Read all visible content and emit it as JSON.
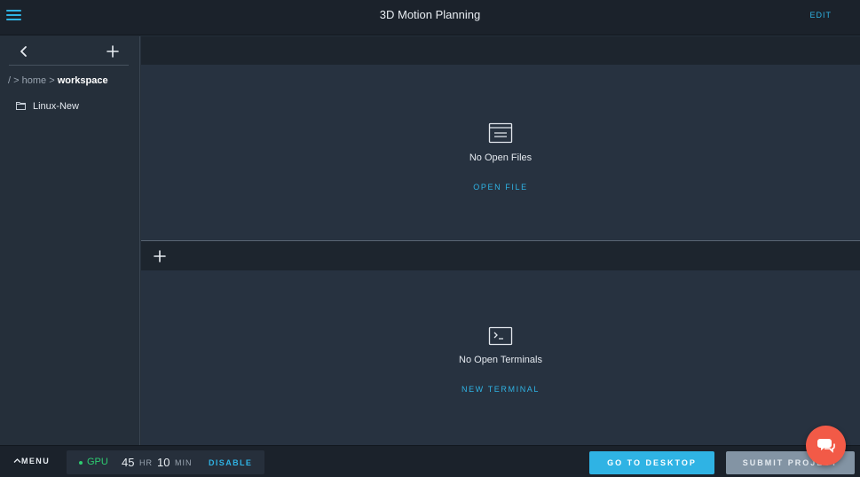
{
  "app": {
    "title": "3D Motion Planning",
    "edit_label": "EDIT",
    "accent_color": "#2fb3e4",
    "icons": {
      "menu": "hamburger-icon",
      "back": "chevron-left-icon",
      "add": "plus-icon",
      "folder": "folder-icon",
      "files": "file-list-icon",
      "terminal": "terminal-icon",
      "chat": "chat-icon",
      "caret": "caret-up-icon"
    }
  },
  "sidebar": {
    "breadcrumb": {
      "root": "/",
      "sep1": ">",
      "home": "home",
      "sep2": ">",
      "current": "workspace"
    },
    "items": [
      {
        "label": "Linux-New",
        "icon": "folder-icon"
      }
    ]
  },
  "editor": {
    "empty_message": "No Open Files",
    "action_label": "OPEN FILE"
  },
  "terminal": {
    "empty_message": "No Open Terminals",
    "action_label": "NEW TERMINAL"
  },
  "bottombar": {
    "menu_label": "MENU",
    "gpu": {
      "label": "GPU",
      "status_color": "#2ecc71",
      "hours": "45",
      "hours_unit": "HR",
      "minutes": "10",
      "minutes_unit": "MIN",
      "disable_label": "DISABLE"
    },
    "desktop_button": "GO TO DESKTOP",
    "submit_button": "SUBMIT PROJECT",
    "submit_color": "#8394a4",
    "chat_color": "#f25a47"
  }
}
